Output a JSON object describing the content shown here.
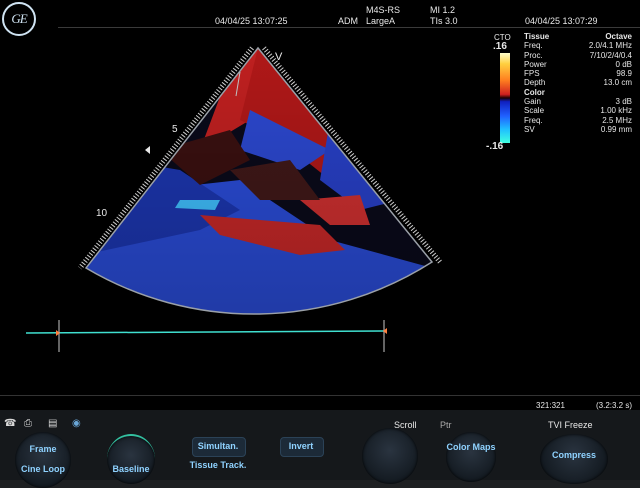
{
  "header": {
    "logo_text": "GE",
    "date_left": "04/04/25 13:07:25",
    "probe": "M4S-RS",
    "preset": "LargeA",
    "operator": "ADM",
    "mi": "MI 1.2",
    "tis": "TIs 3.0",
    "date_right": "04/04/25 13:07:29"
  },
  "colorbar": {
    "label": "CTO",
    "top_value": ".16",
    "bottom_value": "-.16",
    "colors": [
      "#ffffcc",
      "#ff8020",
      "#d02020",
      "#1020c0",
      "#20c0ff",
      "#40ffe0"
    ]
  },
  "params": {
    "tissue_head": "Tissue",
    "tissue_head_value": "Octave",
    "tissue_rows": [
      {
        "key": "Freq.",
        "value": "2.0/4.1 MHz"
      },
      {
        "key": "Proc.",
        "value": "7/10/2/4/0.4"
      },
      {
        "key": "Power",
        "value": "0 dB"
      },
      {
        "key": "FPS",
        "value": "98.9"
      },
      {
        "key": "Depth",
        "value": "13.0 cm"
      }
    ],
    "color_head": "Color",
    "color_rows": [
      {
        "key": "Gain",
        "value": "3 dB"
      },
      {
        "key": "Scale",
        "value": "1.00 kHz"
      },
      {
        "key": "Freq.",
        "value": "2.5 MHz"
      },
      {
        "key": "SV",
        "value": "0.99 mm"
      }
    ]
  },
  "image": {
    "apex_marker": "V",
    "depth_labels": [
      "5",
      "10"
    ]
  },
  "status": {
    "frame_count": "321:321",
    "duration": "(3.2:3.2 s)",
    "scroll": "Scroll",
    "ptr": "Ptr",
    "mode": "TVI Freeze"
  },
  "controls": {
    "frame": "Frame",
    "cine_loop": "Cine Loop",
    "baseline": "Baseline",
    "simultan": "Simultan.",
    "tissue_track": "Tissue Track.",
    "invert": "Invert",
    "color_maps": "Color Maps",
    "compress": "Compress"
  },
  "colors": {
    "control_text": "#8fd2ff",
    "timeline": "#40e0d0",
    "accent_ring": "#33c0a0"
  }
}
